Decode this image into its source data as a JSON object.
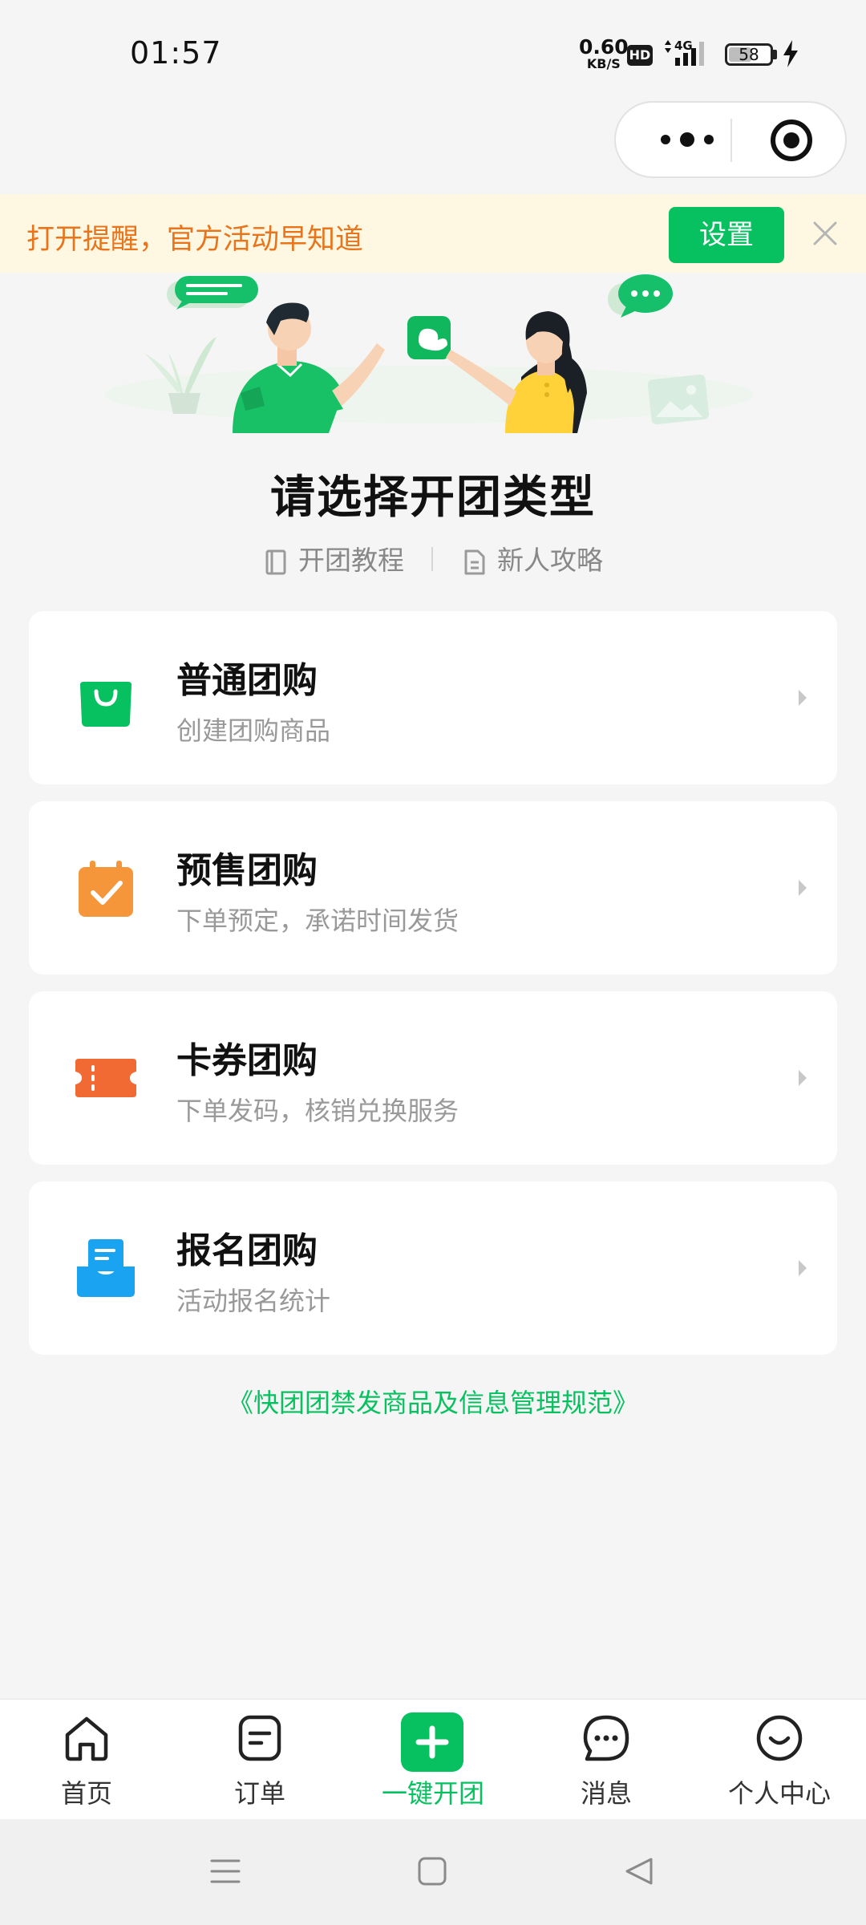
{
  "status_bar": {
    "time": "01:57",
    "net_speed": "0.60",
    "net_unit": "KB/S",
    "hd": "HD",
    "network": "4G",
    "battery": "58"
  },
  "banner": {
    "text": "打开提醒，官方活动早知道",
    "button": "设置"
  },
  "header": {
    "title": "请选择开团类型",
    "links": [
      "开团教程",
      "新人攻略"
    ]
  },
  "options": [
    {
      "title": "普通团购",
      "subtitle": "创建团购商品",
      "icon": "shopping-bag-icon",
      "color": "#07c160"
    },
    {
      "title": "预售团购",
      "subtitle": "下单预定，承诺时间发货",
      "icon": "calendar-check-icon",
      "color": "#f6963a"
    },
    {
      "title": "卡券团购",
      "subtitle": "下单发码，核销兑换服务",
      "icon": "ticket-icon",
      "color": "#f26a33"
    },
    {
      "title": "报名团购",
      "subtitle": "活动报名统计",
      "icon": "inbox-form-icon",
      "color": "#1aa3f0"
    }
  ],
  "rules_link": "《快团团禁发商品及信息管理规范》",
  "tabbar": [
    {
      "label": "首页",
      "icon": "home-icon"
    },
    {
      "label": "订单",
      "icon": "order-icon"
    },
    {
      "label": "一键开团",
      "icon": "plus-icon",
      "active": true
    },
    {
      "label": "消息",
      "icon": "message-icon"
    },
    {
      "label": "个人中心",
      "icon": "profile-icon"
    }
  ],
  "colors": {
    "accent": "#07c160",
    "banner_bg": "#fef7e2",
    "banner_text": "#e8741c"
  }
}
